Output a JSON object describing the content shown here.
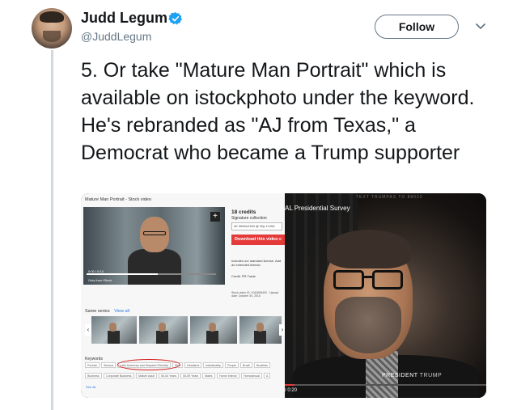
{
  "user": {
    "display_name": "Judd Legum",
    "handle": "@JuddLegum",
    "verified": true,
    "verified_icon": "verified-badge-icon"
  },
  "header": {
    "follow_label": "Follow",
    "menu_icon": "chevron-down-icon"
  },
  "tweet": {
    "text": "5. Or take \"Mature Man Portrait\" which is available on istockphoto under the keyword. He's rebranded as \"AJ from Texas,\" a Democrat who became a Trump supporter"
  },
  "media": {
    "left": {
      "page_title": "Mature Man Portrait - Stock video",
      "credits": "18 credits",
      "collection": "Signature collection",
      "resolution": "4K 3840x2160 @ 30p H.264",
      "download_label": "Download this video c",
      "includes_text": "Includes our standard license. Add an extended license.",
      "credit_text": "Credit: PR Trade",
      "stock_id": "Stock video ID: 1042656492 · Upload date: October 30, 2016",
      "video_time": "0:00 / 0:13",
      "video_note": "Only from iStock",
      "same_series": "Same series",
      "view_all": "View all",
      "keywords_label": "Keywords",
      "keywords_row1": [
        "Portrait",
        "Serious",
        "Latin American and Hispanic Ethnicity",
        "Men",
        "Headshot",
        "Individuality",
        "People",
        "Brazil",
        "Brazilian"
      ],
      "keywords_row2": [
        "Business",
        "Corporate Business",
        "Mature Adult",
        "50-54 Years",
        "55-59 Years",
        "Males",
        "Home Interior",
        "Homosexual",
        "A"
      ],
      "see_all": "See all",
      "highlight_color": "#d32020"
    },
    "right": {
      "survey_label": "AL Presidential Survey",
      "ticker": "TEXT TRUMPAS TO 88022",
      "lower_third_1": "PRESIDENT",
      "lower_third_2": "TRUMP",
      "time": "/ 0:20",
      "progress_fraction": 0.05,
      "accent_color": "#e53a3a"
    }
  },
  "colors": {
    "follow_border": "#657786",
    "verified_blue": "#1da1f2",
    "download_red": "#e53a3a"
  }
}
